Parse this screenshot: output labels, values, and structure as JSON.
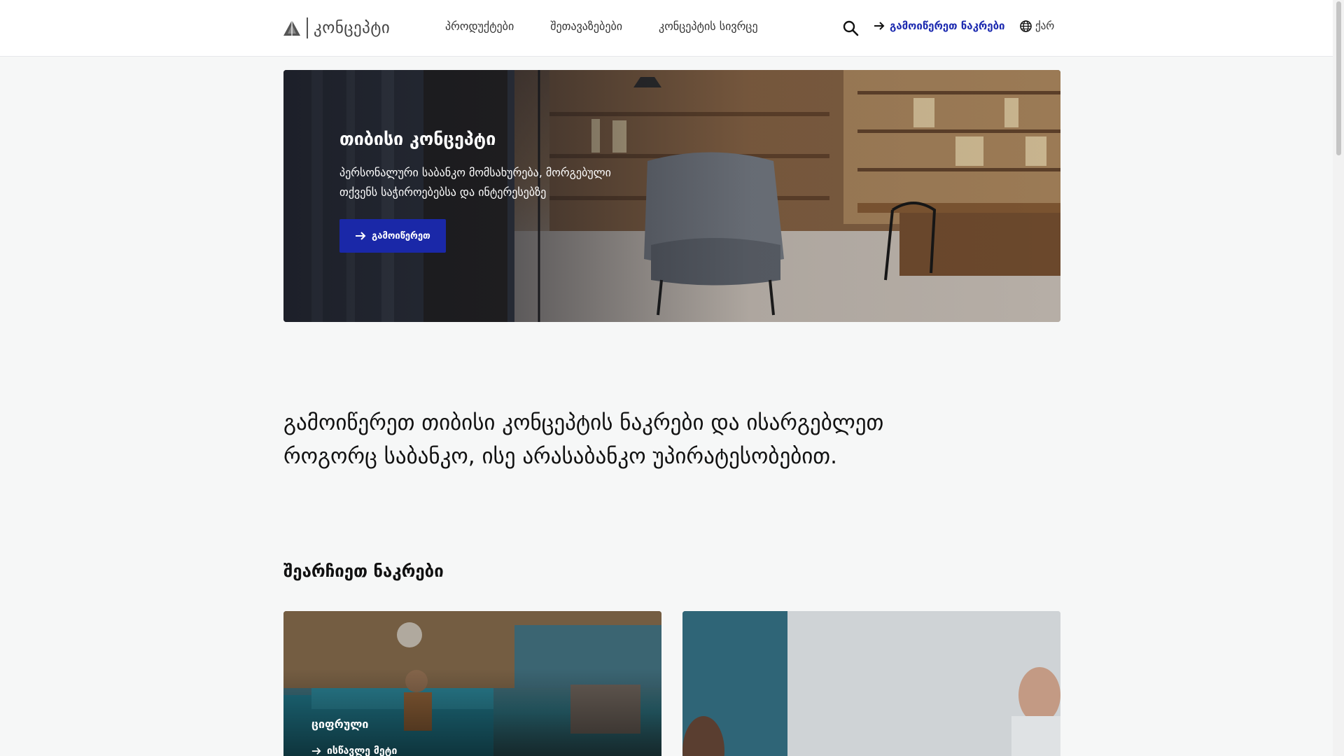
{
  "header": {
    "logo_text": "კონცეპტი",
    "nav": [
      {
        "label": "პროდუქტები"
      },
      {
        "label": "შეთავაზებები"
      },
      {
        "label": "კონცეპტის სივრცე"
      }
    ],
    "order_link": "გამოიწერეთ ნაკრები",
    "language": "ქარ"
  },
  "hero": {
    "title": "თიბისი კონცეპტი",
    "description_line1": "პერსონალური საბანკო მომსახურება, მორგებული",
    "description_line2": "თქვენს საჭიროებებსა და ინტერესებზე",
    "button_label": "გამოიწერეთ"
  },
  "intro": {
    "line1": "გამოიწერეთ თიბისი კონცეპტის ნაკრები და ისარგებლეთ",
    "line2": "როგორც საბანკო, ისე არასაბანკო უპირატესობებით."
  },
  "choose": {
    "title": "შეარჩიეთ ნაკრები",
    "cards": [
      {
        "label": "ციფრული",
        "link": "ისწავლე მეტი"
      },
      {
        "label": "",
        "link": ""
      }
    ]
  },
  "colors": {
    "accent": "#1a28a8",
    "link": "#1d2bb0",
    "background": "#f6f7f7"
  }
}
